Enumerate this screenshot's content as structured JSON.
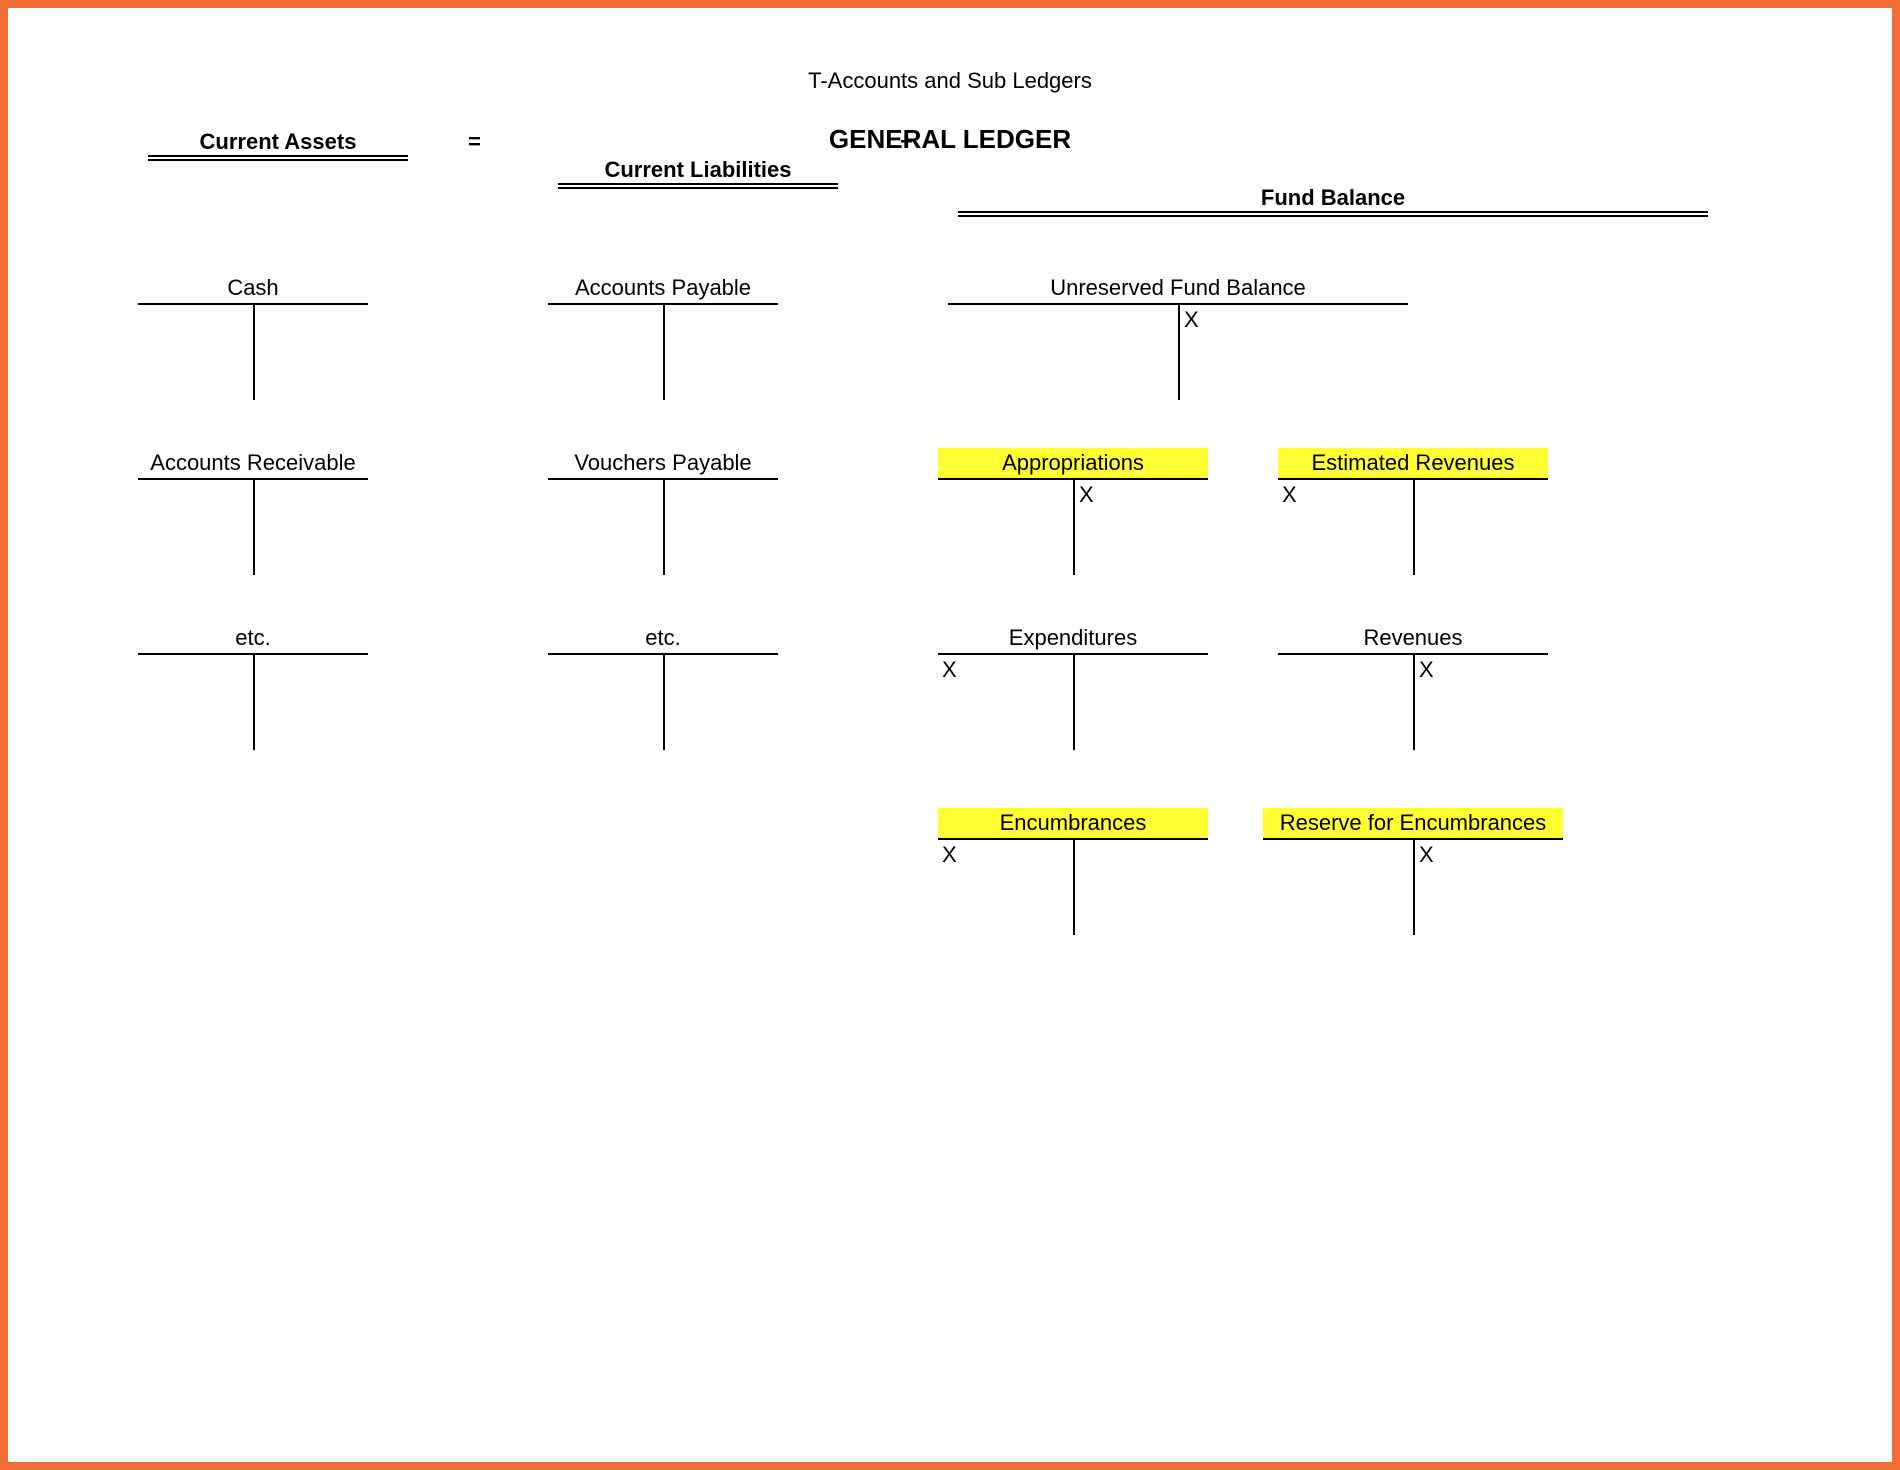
{
  "page_title": "T-Accounts and Sub Ledgers",
  "main_title": "GENERAL LEDGER",
  "equation": {
    "assets_label": "Current Assets",
    "eq": "=",
    "liabilities_label": "Current Liabilities",
    "plus": "+",
    "fund_balance_label": "Fund Balance"
  },
  "accounts": {
    "cash": {
      "title": "Cash",
      "debit": "",
      "credit": ""
    },
    "ar": {
      "title": "Accounts Receivable",
      "debit": "",
      "credit": ""
    },
    "assets_etc": {
      "title": "etc.",
      "debit": "",
      "credit": ""
    },
    "ap": {
      "title": "Accounts Payable",
      "debit": "",
      "credit": ""
    },
    "vp": {
      "title": "Vouchers Payable",
      "debit": "",
      "credit": ""
    },
    "liab_etc": {
      "title": "etc.",
      "debit": "",
      "credit": ""
    },
    "unreserved": {
      "title": "Unreserved Fund Balance",
      "debit": "",
      "credit": "X"
    },
    "appropriations": {
      "title": "Appropriations",
      "debit": "",
      "credit": "X"
    },
    "est_revenues": {
      "title": "Estimated Revenues",
      "debit": "X",
      "credit": ""
    },
    "expenditures": {
      "title": "Expenditures",
      "debit": "X",
      "credit": ""
    },
    "revenues": {
      "title": "Revenues",
      "debit": "",
      "credit": "X"
    },
    "encumbrances": {
      "title": "Encumbrances",
      "debit": "X",
      "credit": ""
    },
    "reserve_encumbrances": {
      "title": "Reserve for Encumbrances",
      "debit": "",
      "credit": "X"
    }
  }
}
